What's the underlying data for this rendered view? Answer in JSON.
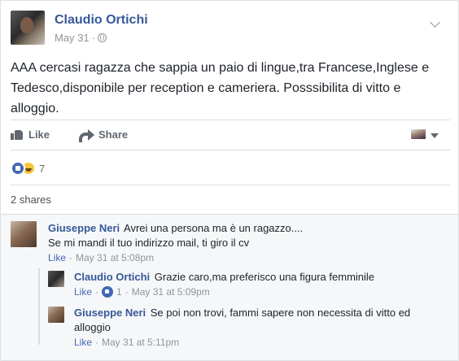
{
  "post": {
    "author": "Claudio Ortichi",
    "date": "May 31",
    "separator": "·",
    "text": "AAA cercasi ragazza che sappia un paio di lingue,tra Francese,Inglese e Tedesco,disponibile per reception e cameriera. Posssibilita di vitto e alloggio."
  },
  "actions": {
    "like_label": "Like",
    "share_label": "Share"
  },
  "reactions": {
    "types": [
      "like",
      "haha"
    ],
    "count": "7"
  },
  "shares": "2 shares",
  "comments": [
    {
      "author": "Giuseppe Neri",
      "text_line1": "Avrei una persona ma è un ragazzo....",
      "text_line2": "Se mi mandi il tuo indirizzo mail, ti giro il cv",
      "like_label": "Like",
      "separator": "·",
      "timestamp": "May 31 at 5:08pm"
    },
    {
      "author": "Claudio Ortichi",
      "text": "Grazie caro,ma preferisco una figura femminile",
      "like_label": "Like",
      "separator": "·",
      "like_count": "1",
      "timestamp": "May 31 at 5:09pm"
    },
    {
      "author": "Giuseppe Neri",
      "text_line1": "Se poi non trovi, fammi sapere non necessita di vitto ed",
      "text_line2": "alloggio",
      "like_label": "Like",
      "separator": "·",
      "timestamp": "May 31 at 5:11pm"
    }
  ],
  "colors": {
    "link_blue": "#365899",
    "like_blue": "#4267b2",
    "meta_gray": "#90949c",
    "text": "#1d2129"
  }
}
